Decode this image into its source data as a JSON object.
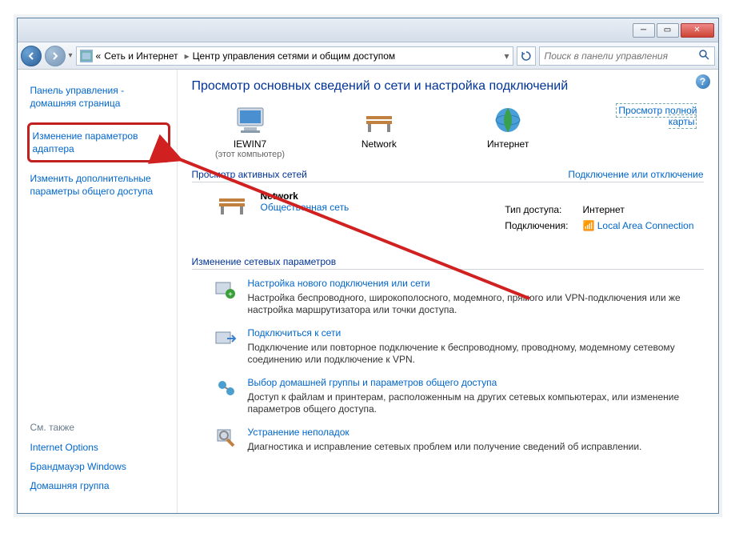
{
  "breadcrumb": {
    "prefix": "«",
    "part1": "Сеть и Интернет",
    "part2": "Центр управления сетями и общим доступом"
  },
  "search": {
    "placeholder": "Поиск в панели управления"
  },
  "sidebar": {
    "home": "Панель управления - домашняя страница",
    "adapter": "Изменение параметров адаптера",
    "sharing": "Изменить дополнительные параметры общего доступа",
    "seealso": "См. также",
    "links": [
      "Internet Options",
      "Брандмауэр Windows",
      "Домашняя группа"
    ]
  },
  "main": {
    "title": "Просмотр основных сведений о сети и настройка подключений",
    "fullmap": "Просмотр полной карты",
    "map": {
      "pc": "IEWIN7",
      "pcsub": "(этот компьютер)",
      "net": "Network",
      "inet": "Интернет"
    },
    "activehead": "Просмотр активных сетей",
    "connlink": "Подключение или отключение",
    "netblock": {
      "name": "Network",
      "type": "Общественная сеть"
    },
    "nettable": {
      "access_label": "Тип доступа:",
      "access_value": "Интернет",
      "conn_label": "Подключения:",
      "conn_value": "Local Area Connection"
    },
    "changehead": "Изменение сетевых параметров",
    "tasks": [
      {
        "title": "Настройка нового подключения или сети",
        "desc": "Настройка беспроводного, широкополосного, модемного, прямого или VPN-подключения или же настройка маршрутизатора или точки доступа."
      },
      {
        "title": "Подключиться к сети",
        "desc": "Подключение или повторное подключение к беспроводному, проводному, модемному сетевому соединению или подключение к VPN."
      },
      {
        "title": "Выбор домашней группы и параметров общего доступа",
        "desc": "Доступ к файлам и принтерам, расположенным на других сетевых компьютерах, или изменение параметров общего доступа."
      },
      {
        "title": "Устранение неполадок",
        "desc": "Диагностика и исправление сетевых проблем или получение сведений об исправлении."
      }
    ]
  }
}
